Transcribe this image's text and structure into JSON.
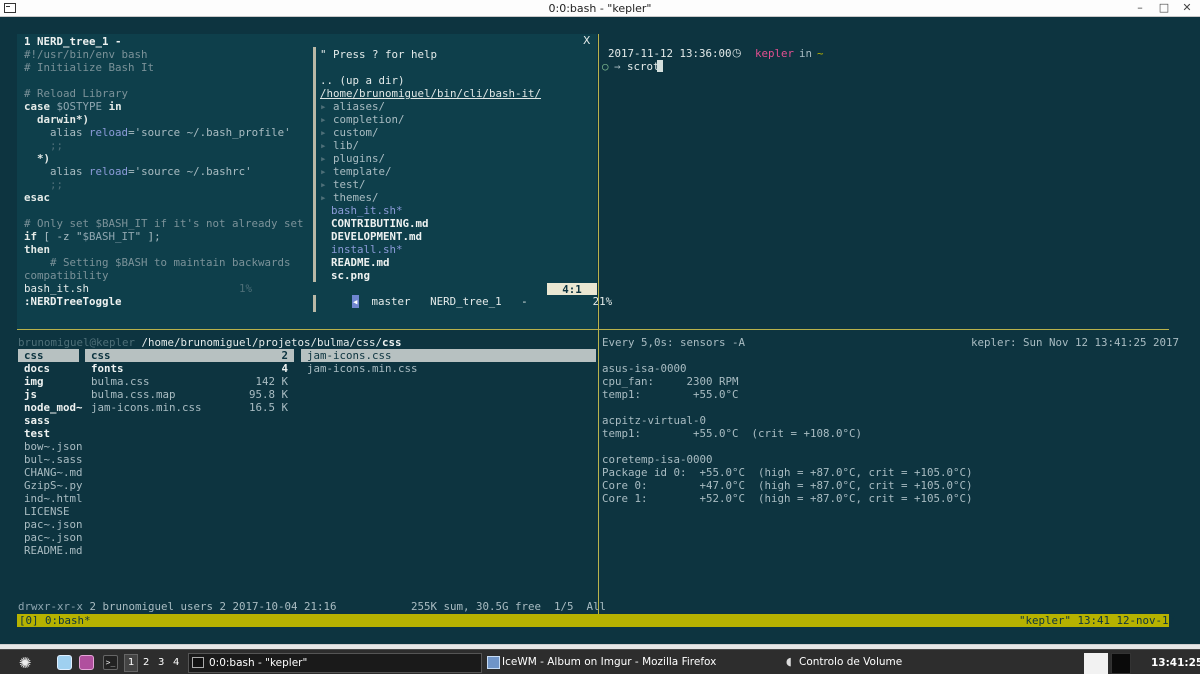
{
  "window": {
    "title": "0:0:bash - \"kepler\""
  },
  "vim": {
    "header": "1 NERD_tree_1 -",
    "close": "X",
    "code": [
      "#!/usr/bin/env bash",
      "# Initialize Bash It",
      "",
      "# Reload Library",
      "case $OSTYPE in",
      "  darwin*)",
      "    alias reload='source ~/.bash_profile'",
      "    ;;",
      "  *)",
      "    alias reload='source ~/.bashrc'",
      "    ;;",
      "esac",
      "",
      "# Only set $BASH_IT if it's not already set",
      "if [ -z \"$BASH_IT\" ];",
      "then",
      "    # Setting $BASH to maintain backwards",
      "compatibility"
    ],
    "status_file": "bash_it.sh",
    "status_pct": "1%",
    "cmdline": ":NERDTreeToggle",
    "nerd": {
      "help": "\" Press ? for help",
      "updir": ".. (up a dir)",
      "path": "/home/brunomiguel/bin/cli/bash-it/",
      "dirs": [
        "aliases/",
        "completion/",
        "custom/",
        "lib/",
        "plugins/",
        "template/",
        "test/",
        "themes/"
      ],
      "files": [
        "bash_it.sh*",
        "CONTRIBUTING.md",
        "DEVELOPMENT.md",
        "install.sh*",
        "README.md",
        "sc.png"
      ],
      "status_branch": "master",
      "status_name": "NERD_tree_1",
      "status_mod": "-",
      "status_pct": "21%",
      "status_pos": "4:1"
    }
  },
  "prompt": {
    "datetime": "2017-11-12 13:36:00",
    "user": "kepler",
    "in": "in",
    "dir": "~",
    "arrow": "→",
    "command": "scrot"
  },
  "ranger": {
    "user_host": "brunomiguel@kepler",
    "path": "/home/brunomiguel/projetos/bulma/css/",
    "path_last": "css",
    "col1": [
      "css",
      "docs",
      "img",
      "js",
      "node_mod~",
      "sass",
      "test",
      "bow~.json",
      "bul~.sass",
      "CHANG~.md",
      "GzipS~.py",
      "ind~.html",
      "LICENSE",
      "pac~.json",
      "pac~.json",
      "README.md"
    ],
    "col2": [
      {
        "name": "css",
        "size": "2"
      },
      {
        "name": "fonts",
        "size": "4"
      },
      {
        "name": "bulma.css",
        "size": "142 K"
      },
      {
        "name": "bulma.css.map",
        "size": "95.8 K"
      },
      {
        "name": "jam-icons.min.css",
        "size": "16.5 K"
      }
    ],
    "col3": [
      "jam-icons.css",
      "jam-icons.min.css"
    ],
    "status_perm": "drwxr-xr-x",
    "status_info": "2 brunomiguel users 2 2017-10-04 21:16",
    "status_right": "255K sum, 30.5G free  1/5  All"
  },
  "sensors": {
    "header_left": "Every 5,0s: sensors -A",
    "header_right": "kepler: Sun Nov 12 13:41:25 2017",
    "lines": [
      "asus-isa-0000",
      "cpu_fan:     2300 RPM",
      "temp1:        +55.0°C",
      "",
      "acpitz-virtual-0",
      "temp1:        +55.0°C  (crit = +108.0°C)",
      "",
      "coretemp-isa-0000",
      "Package id 0:  +55.0°C  (high = +87.0°C, crit = +105.0°C)",
      "Core 0:        +47.0°C  (high = +87.0°C, crit = +105.0°C)",
      "Core 1:        +52.0°C  (high = +87.0°C, crit = +105.0°C)"
    ]
  },
  "tmux": {
    "left": "[0] 0:bash*",
    "right": "\"kepler\" 13:41 12-nov-17"
  },
  "taskbar": {
    "workspaces": [
      "1",
      "2",
      "3",
      "4"
    ],
    "tasks": [
      "0:0:bash - \"kepler\"",
      "IceWM - Album on Imgur - Mozilla Firefox",
      "Controlo de Volume"
    ],
    "clock": "13:41:25"
  }
}
